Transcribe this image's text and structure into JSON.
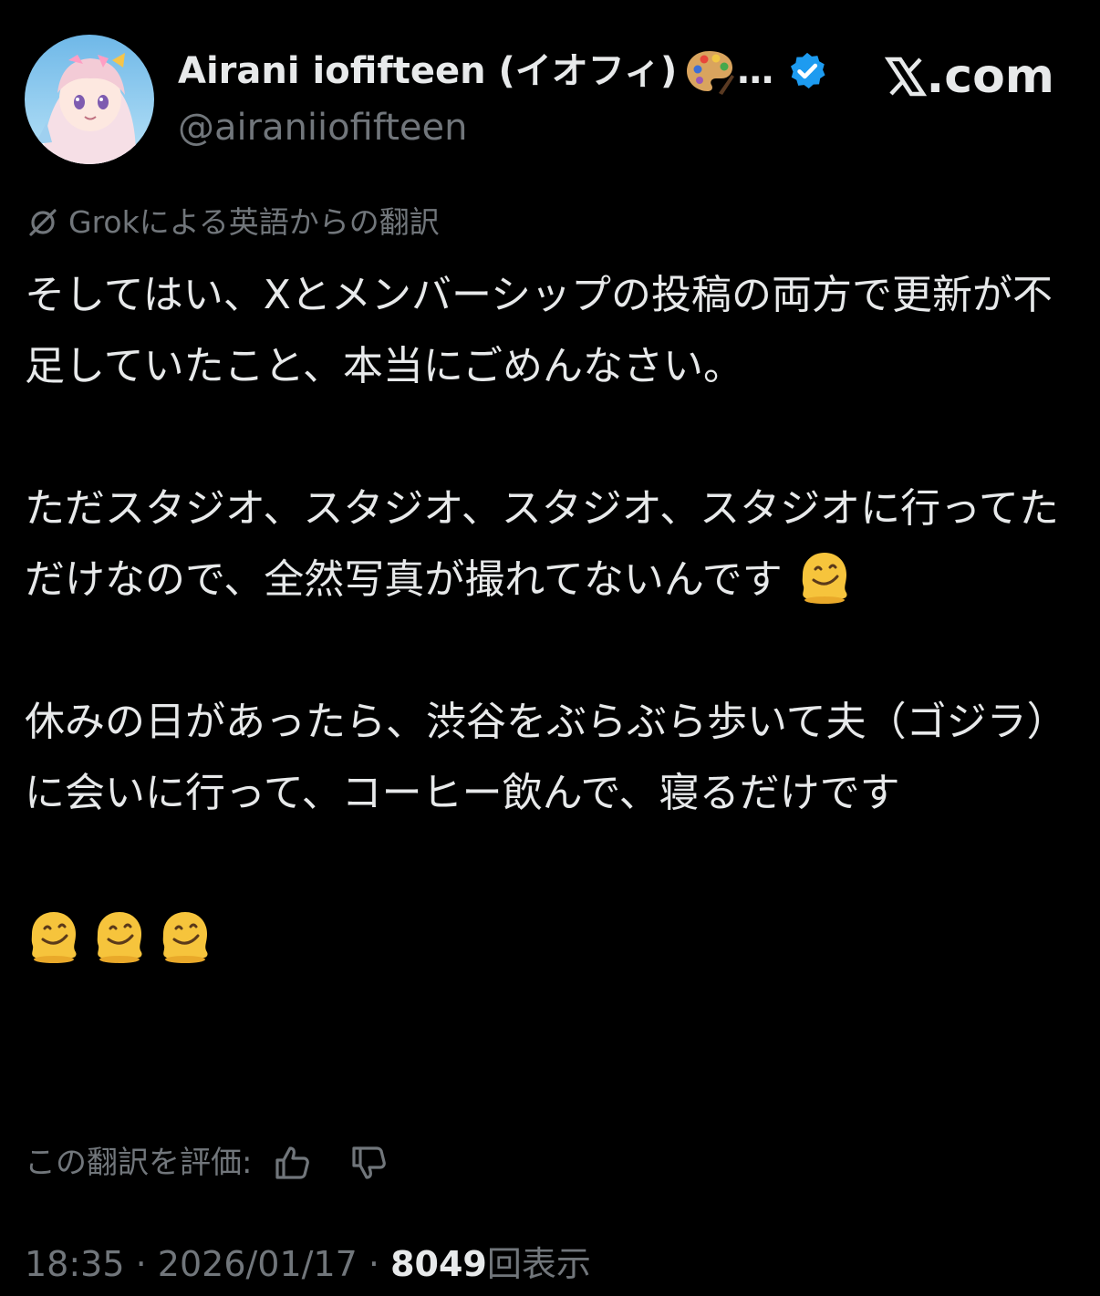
{
  "header": {
    "display_name": "Airani iofifteen (イオフィ)",
    "ellipsis": "…",
    "handle": "@airaniiofifteen",
    "brand": ".com",
    "icons": {
      "avatar": "avatar-image",
      "palette": "artist-palette-icon",
      "verified": "verified-badge-icon",
      "brand": "x-logo-icon"
    },
    "verified_color": "#1d9bf0"
  },
  "translation_notice": "Grokによる英語からの翻訳",
  "body": {
    "paragraph_1": "そしてはい、Xとメンバーシップの投稿の両方で更新が不足していたこと、本当にごめんなさい。",
    "paragraph_2": "ただスタジオ、スタジオ、スタジオ、スタジオに行ってただけなので、全然写真が撮れてないんです",
    "paragraph_3": "休みの日があったら、渋谷をぶらぶら歩いて夫（ゴジラ）に会いに行って、コーヒー飲んで、寝るだけです",
    "emoji": "melting-face-icon",
    "trailing_emoji_count": 3
  },
  "rating": {
    "label": "この翻訳を評価:",
    "thumbs_up": "thumbs-up-icon",
    "thumbs_down": "thumbs-down-icon"
  },
  "meta": {
    "time": "18:35",
    "separator": "·",
    "date": "2026/01/17",
    "views_count": "8049",
    "views_label": "回表示"
  },
  "colors": {
    "background": "#000000",
    "primary_text": "#e7e9ea",
    "secondary_text": "#71767b"
  }
}
